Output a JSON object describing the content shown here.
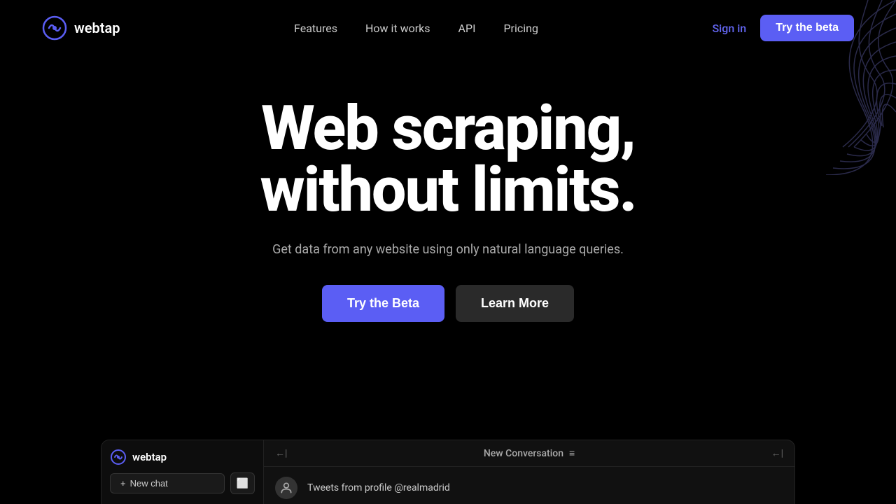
{
  "brand": {
    "name": "webtap",
    "logo_alt": "webtap logo"
  },
  "nav": {
    "links": [
      {
        "label": "Features",
        "href": "#"
      },
      {
        "label": "How it works",
        "href": "#"
      },
      {
        "label": "API",
        "href": "#"
      },
      {
        "label": "Pricing",
        "href": "#"
      }
    ],
    "signin_label": "Sign in",
    "try_beta_label": "Try the beta"
  },
  "hero": {
    "title_line1": "Web scraping,",
    "title_line2": "without limits.",
    "subtitle": "Get data from any website using only natural language queries.",
    "btn_try": "Try the Beta",
    "btn_learn": "Learn More"
  },
  "bottom_panel": {
    "sidebar": {
      "brand": "webtap",
      "new_chat_label": "New chat"
    },
    "main": {
      "back_label": "←|",
      "conversation_label": "New Conversation",
      "menu_label": "≡",
      "collapse_label": "←|",
      "tweet_query": "Tweets from profile @realmadrid"
    }
  },
  "colors": {
    "accent": "#5b5ef4",
    "signin": "#6366f1",
    "bg_dark": "#000000",
    "bg_panel": "#0d0d0d"
  }
}
